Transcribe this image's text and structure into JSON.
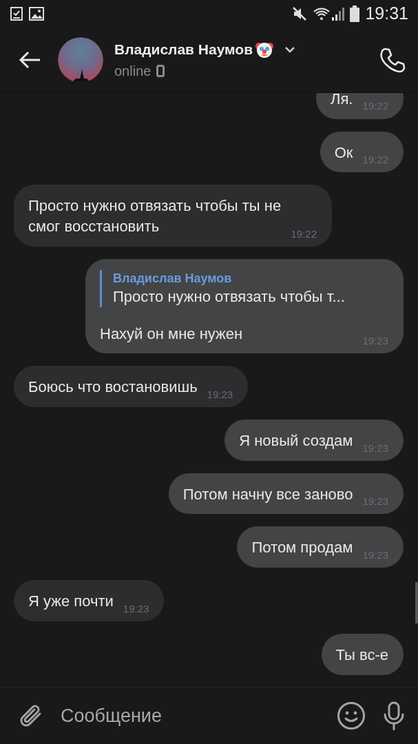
{
  "status_bar": {
    "time": "19:31"
  },
  "header": {
    "name": "Владислав Наумов",
    "status": "online"
  },
  "messages": [
    {
      "kind": "outgoing",
      "text": "Ля.",
      "time": "19:22"
    },
    {
      "kind": "outgoing",
      "text": "Ок",
      "time": "19:22"
    },
    {
      "kind": "incoming",
      "text": "Просто нужно отвязать чтобы ты не смог восстановить",
      "time": "19:22"
    },
    {
      "kind": "outgoing",
      "text": "Нахуй он мне нужен",
      "time": "19:23",
      "reply": {
        "author": "Владислав Наумов",
        "text": "Просто нужно отвязать чтобы т..."
      }
    },
    {
      "kind": "incoming",
      "text": "Боюсь что востановишь",
      "time": "19:23"
    },
    {
      "kind": "outgoing",
      "text": "Я новый создам",
      "time": "19:23"
    },
    {
      "kind": "outgoing",
      "text": "Потом начну все заново",
      "time": "19:23"
    },
    {
      "kind": "outgoing",
      "text": "Потом продам",
      "time": "19:23"
    },
    {
      "kind": "incoming",
      "text": "Я уже почти",
      "time": "19:23"
    },
    {
      "kind": "outgoing",
      "text": "Ты вс-е"
    }
  ],
  "composer": {
    "placeholder": "Сообщение"
  }
}
